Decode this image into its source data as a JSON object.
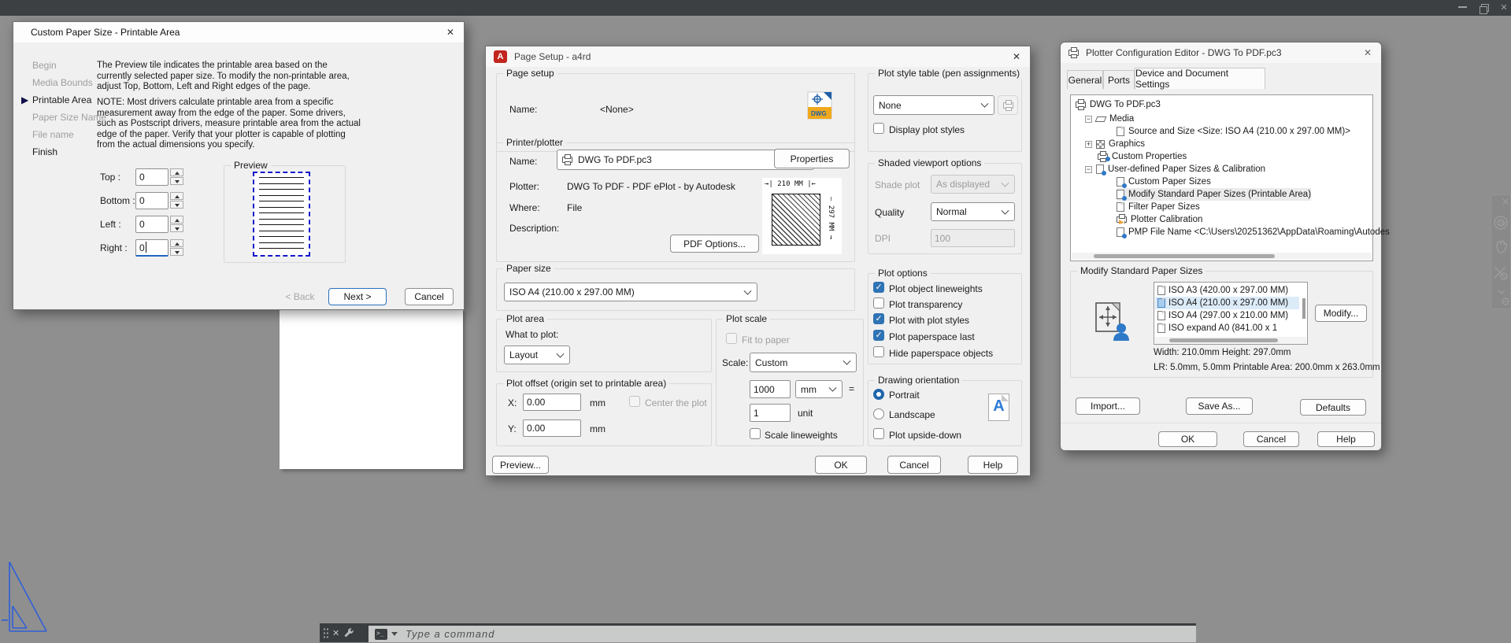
{
  "custom_paper_dialog": {
    "title": "Custom Paper Size - Printable Area",
    "steps": [
      {
        "label": "Begin",
        "state": "disabled"
      },
      {
        "label": "Media Bounds",
        "state": "disabled"
      },
      {
        "label": "Printable Area",
        "state": "current"
      },
      {
        "label": "Paper Size Name",
        "state": "disabled"
      },
      {
        "label": "File name",
        "state": "disabled"
      },
      {
        "label": "Finish",
        "state": "enabled"
      }
    ],
    "description1": "The Preview tile indicates the printable area based on the currently selected paper size. To modify the non-printable area, adjust Top, Bottom, Left and Right edges of the page.",
    "description2": "NOTE: Most drivers calculate printable area from a specific measurement away from the edge of the paper. Some drivers, such as Postscript drivers, measure printable area from the actual edge of the paper. Verify that your plotter is capable of plotting from the actual dimensions you specify.",
    "fields": [
      {
        "label": "Top :",
        "value": "0"
      },
      {
        "label": "Bottom :",
        "value": "0"
      },
      {
        "label": "Left :",
        "value": "0"
      },
      {
        "label": "Right :",
        "value": "0"
      }
    ],
    "preview_label": "Preview",
    "buttons": {
      "back": "< Back",
      "next": "Next >",
      "cancel": "Cancel"
    }
  },
  "page_setup_dialog": {
    "title": "Page Setup - a4rd",
    "page_setup_group": {
      "label": "Page setup",
      "name_label": "Name:",
      "name_value": "<None>"
    },
    "printer_group": {
      "label": "Printer/plotter",
      "name_label": "Name:",
      "name_value": "DWG To PDF.pc3",
      "properties_button": "Properties",
      "plotter_label": "Plotter:",
      "plotter_value": "DWG To PDF - PDF ePlot - by Autodesk",
      "where_label": "Where:",
      "where_value": "File",
      "description_label": "Description:",
      "pdf_options_button": "PDF Options...",
      "dim_width": "210 MM",
      "dim_height": "297 MM"
    },
    "paper_size_group": {
      "label": "Paper size",
      "value": "ISO A4 (210.00 x 297.00 MM)"
    },
    "plot_area_group": {
      "label": "Plot area",
      "what_label": "What to plot:",
      "what_value": "Layout"
    },
    "plot_offset_group": {
      "label": "Plot offset (origin set to printable area)",
      "x_label": "X:",
      "x_value": "0.00",
      "x_unit": "mm",
      "y_label": "Y:",
      "y_value": "0.00",
      "y_unit": "mm",
      "center_label": "Center the plot"
    },
    "plot_style_group": {
      "label": "Plot style table (pen assignments)",
      "value": "None",
      "display_label": "Display plot styles"
    },
    "shaded_group": {
      "label": "Shaded viewport options",
      "shade_label": "Shade plot",
      "shade_value": "As displayed",
      "quality_label": "Quality",
      "quality_value": "Normal",
      "dpi_label": "DPI",
      "dpi_value": "100"
    },
    "plot_options_group": {
      "label": "Plot options",
      "options": [
        {
          "label": "Plot object lineweights",
          "checked": true
        },
        {
          "label": "Plot transparency",
          "checked": false
        },
        {
          "label": "Plot with plot styles",
          "checked": true
        },
        {
          "label": "Plot paperspace last",
          "checked": true
        },
        {
          "label": "Hide paperspace objects",
          "checked": false
        }
      ]
    },
    "plot_scale_group": {
      "label": "Plot scale",
      "fit_label": "Fit to paper",
      "scale_label": "Scale:",
      "scale_value": "Custom",
      "len_value": "1000",
      "len_unit": "mm",
      "equals": "=",
      "unit_value": "1",
      "unit_label": "unit",
      "lineweights_label": "Scale lineweights"
    },
    "orientation_group": {
      "label": "Drawing orientation",
      "portrait": "Portrait",
      "landscape": "Landscape",
      "upside_label": "Plot upside-down"
    },
    "buttons": {
      "preview": "Preview...",
      "ok": "OK",
      "cancel": "Cancel",
      "help": "Help"
    }
  },
  "plotter_config_dialog": {
    "title": "Plotter Configuration Editor - DWG To PDF.pc3",
    "tabs": [
      {
        "label": "General"
      },
      {
        "label": "Ports"
      },
      {
        "label": "Device and Document Settings"
      }
    ],
    "tree": [
      {
        "label": "DWG To PDF.pc3"
      },
      {
        "label": "Media"
      },
      {
        "label": "Source and Size <Size: ISO A4 (210.00 x 297.00 MM)>"
      },
      {
        "label": "Graphics"
      },
      {
        "label": "Custom Properties"
      },
      {
        "label": "User-defined Paper Sizes & Calibration"
      },
      {
        "label": "Custom Paper Sizes"
      },
      {
        "label": "Modify Standard Paper Sizes (Printable Area)"
      },
      {
        "label": "Filter Paper Sizes"
      },
      {
        "label": "Plotter Calibration"
      },
      {
        "label": "PMP File Name <C:\\Users\\20251362\\AppData\\Roaming\\Autodes"
      }
    ],
    "modify_group": {
      "label": "Modify Standard Paper Sizes",
      "sizes": [
        {
          "label": "ISO A3 (420.00 x 297.00 MM)"
        },
        {
          "label": "ISO A4 (210.00 x 297.00 MM)"
        },
        {
          "label": "ISO A4 (297.00 x 210.00 MM)"
        },
        {
          "label": "ISO expand A0 (841.00 x 1"
        }
      ],
      "modify_button": "Modify...",
      "width_height": "Width: 210.0mm Height: 297.0mm",
      "printable": "LR: 5.0mm, 5.0mm  Printable Area: 200.0mm x 263.0mm"
    },
    "buttons": {
      "import": "Import...",
      "save_as": "Save As...",
      "defaults": "Defaults",
      "ok": "OK",
      "cancel": "Cancel",
      "help": "Help"
    }
  },
  "command_bar": {
    "placeholder": "Type a command"
  }
}
